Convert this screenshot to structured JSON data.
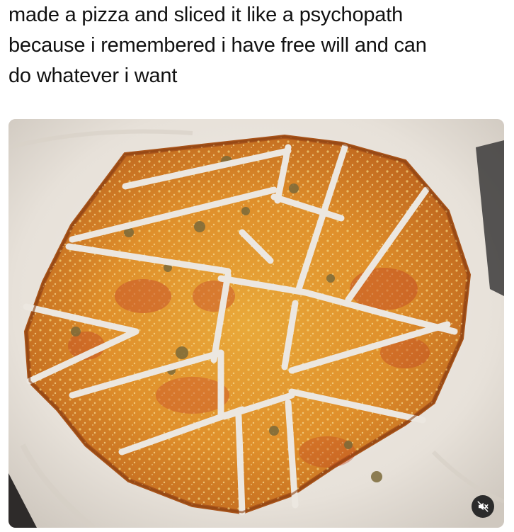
{
  "post": {
    "caption": "made a pizza and sliced it like a psychopath\nbecause i remembered i have free will and can\ndo whatever i want"
  },
  "media": {
    "type": "photo",
    "subject": "pizza-photo",
    "controls": {
      "mute_icon": "speaker-muted-icon"
    }
  },
  "colors": {
    "text": "#111111",
    "crust": "#c8741f",
    "cheese": "#e0a12f",
    "sauce": "#c9532a",
    "parchment": "#ebe6df",
    "mute_bg": "#2b2b2b"
  }
}
